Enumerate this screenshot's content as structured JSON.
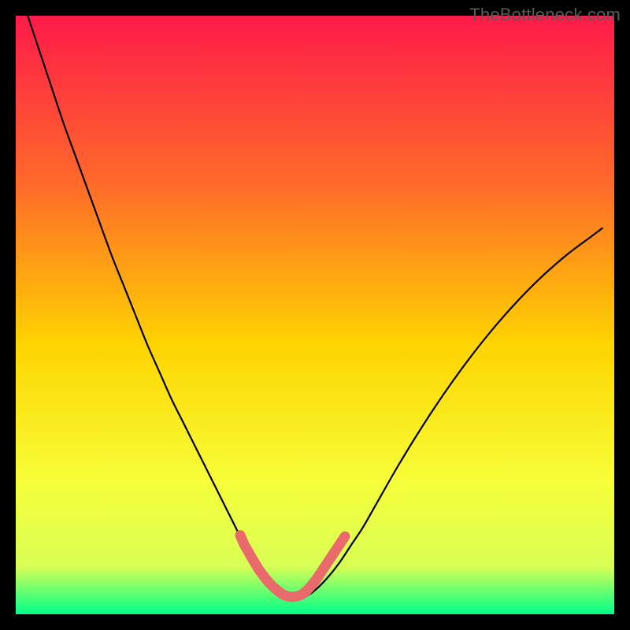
{
  "watermark": "TheBottleneck.com",
  "colors": {
    "bg": "#000000",
    "grad_top": "#ff1a4a",
    "grad_upper_mid": "#ff6a2a",
    "grad_mid": "#ffd400",
    "grad_lower_mid": "#f7ff3a",
    "grad_low": "#d8ff55",
    "grad_bottom": "#00ff88",
    "curve": "#000000",
    "highlight": "#e86a6a"
  },
  "chart_data": {
    "type": "line",
    "title": "",
    "xlabel": "",
    "ylabel": "",
    "xlim": [
      0,
      100
    ],
    "ylim": [
      0,
      100
    ],
    "series": [
      {
        "name": "bottleneck-curve",
        "x": [
          2,
          4,
          6,
          8,
          10,
          12,
          14,
          16,
          18,
          20,
          22,
          24,
          26,
          28,
          30,
          32,
          33.5,
          35,
          36.5,
          38,
          39.5,
          41,
          42.5,
          44,
          45.5,
          47,
          48.5,
          50,
          52,
          54,
          56,
          58,
          60,
          64,
          68,
          72,
          76,
          80,
          84,
          88,
          92,
          96,
          98
        ],
        "y": [
          100,
          94,
          88,
          82,
          76.5,
          71,
          65.5,
          60,
          55,
          50,
          45,
          40.5,
          36,
          32,
          28,
          24,
          21,
          18,
          15,
          12,
          9.5,
          7.3,
          5.5,
          4,
          3,
          2.8,
          3,
          4,
          6,
          8.5,
          11.5,
          14.5,
          18,
          25,
          31.5,
          37.5,
          43,
          48,
          52.5,
          56.5,
          60,
          63,
          64.5
        ]
      },
      {
        "name": "valley-highlight-left",
        "x": [
          37.5,
          38.2,
          39,
          39.8,
          40.6,
          41.4,
          42.2,
          43,
          43.8
        ],
        "y": [
          13.2,
          11.6,
          10.2,
          8.8,
          7.5,
          6.4,
          5.4,
          4.6,
          3.9
        ]
      },
      {
        "name": "valley-highlight-bottom",
        "x": [
          43.8,
          44.6,
          45.4,
          46.2,
          47,
          47.8,
          48.6
        ],
        "y": [
          3.9,
          3.3,
          3,
          2.9,
          3,
          3.3,
          3.9
        ]
      },
      {
        "name": "valley-highlight-right",
        "x": [
          48.6,
          49.4,
          50.2,
          51,
          51.8,
          52.6,
          53.4,
          54.2,
          55
        ],
        "y": [
          3.9,
          4.8,
          5.8,
          7,
          8.2,
          9.4,
          10.6,
          11.8,
          13
        ]
      }
    ],
    "highlight_dot_radius": 6
  }
}
